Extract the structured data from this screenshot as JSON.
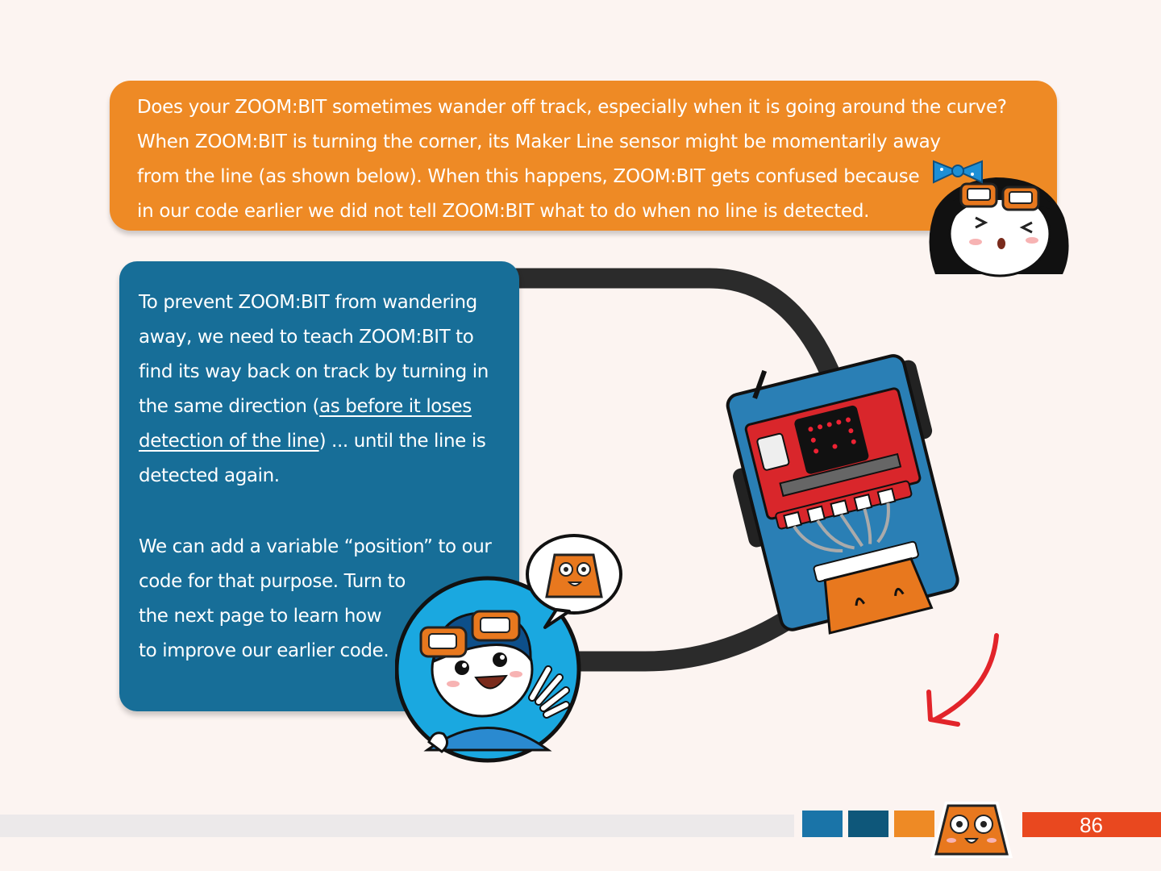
{
  "intro": {
    "lines": [
      "Does your ZOOM:BIT sometimes wander off track, especially when it is going around the curve?",
      "When ZOOM:BIT is turning the corner, its Maker Line sensor might be momentarily away",
      "from the line (as shown below). When this happens, ZOOM:BIT gets confused because",
      "in our code earlier we did not tell ZOOM:BIT what to do when no line is detected."
    ]
  },
  "panel": {
    "para1": {
      "line1": "To prevent ZOOM:BIT from wandering",
      "line2": "away, we need to teach ZOOM:BIT to",
      "line3": "find its way back on track by turning in",
      "line4_pre": "the same direction (",
      "line4_link": "as before it loses",
      "line5_link": "detection of the line",
      "line5_post": ") ... until the line is",
      "line6": "detected again."
    },
    "para2": {
      "line1": "We can add a variable “position” to our",
      "line2": "code for that purpose. Turn to",
      "line3": "the next page to learn how",
      "line4": "to improve our earlier code."
    }
  },
  "footer": {
    "page_number": "86"
  },
  "colors": {
    "background": "#fcf4f1",
    "orange": "#ee8a25",
    "blue_panel": "#176e98",
    "track": "#2b2b2b",
    "robot_blue": "#2a7fb5",
    "board_red": "#d9262b",
    "arrow_red": "#e2242a",
    "footer_red": "#e9481f"
  },
  "icons": [
    "girl-mascot",
    "boy-mascot",
    "zoombit-face-icon",
    "robot-top-view",
    "curved-arrow-icon"
  ]
}
